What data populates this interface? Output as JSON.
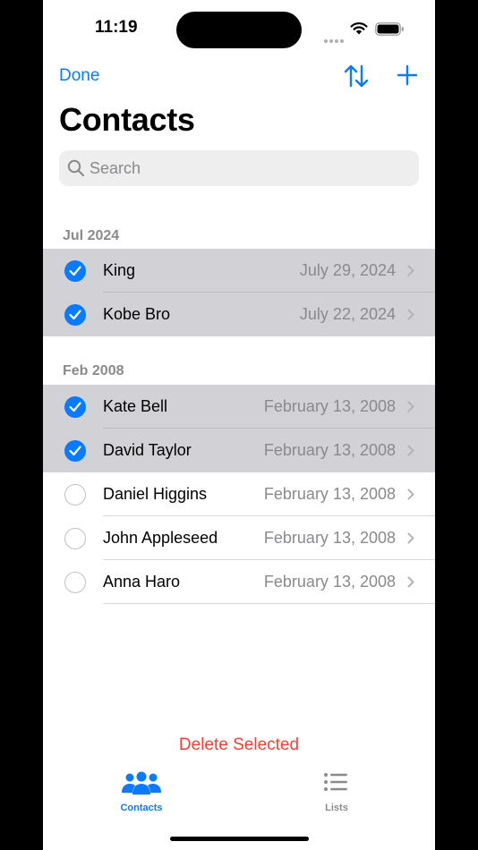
{
  "status_bar": {
    "time": "11:19"
  },
  "nav": {
    "done_label": "Done",
    "title": "Contacts"
  },
  "search": {
    "placeholder": "Search"
  },
  "sections": [
    {
      "header": "Jul 2024",
      "rows": [
        {
          "name": "King",
          "date": "July 29, 2024",
          "selected": true
        },
        {
          "name": "Kobe Bro",
          "date": "July 22, 2024",
          "selected": true
        }
      ]
    },
    {
      "header": "Feb 2008",
      "rows": [
        {
          "name": "Kate Bell",
          "date": "February 13, 2008",
          "selected": true
        },
        {
          "name": "David Taylor",
          "date": "February 13, 2008",
          "selected": true
        },
        {
          "name": "Daniel Higgins",
          "date": "February 13, 2008",
          "selected": false
        },
        {
          "name": "John Appleseed",
          "date": "February 13, 2008",
          "selected": false
        },
        {
          "name": "Anna Haro",
          "date": "February 13, 2008",
          "selected": false
        }
      ]
    }
  ],
  "actions": {
    "delete_selected": "Delete Selected"
  },
  "tab_bar": {
    "tabs": [
      {
        "label": "Contacts",
        "icon": "people-icon",
        "active": true
      },
      {
        "label": "Lists",
        "icon": "list-icon",
        "active": false
      }
    ]
  },
  "colors": {
    "accent": "#0a7aff",
    "destructive": "#ff3b30",
    "selected_row": "#d1d1d6",
    "secondary_text": "#8a8a8e"
  }
}
